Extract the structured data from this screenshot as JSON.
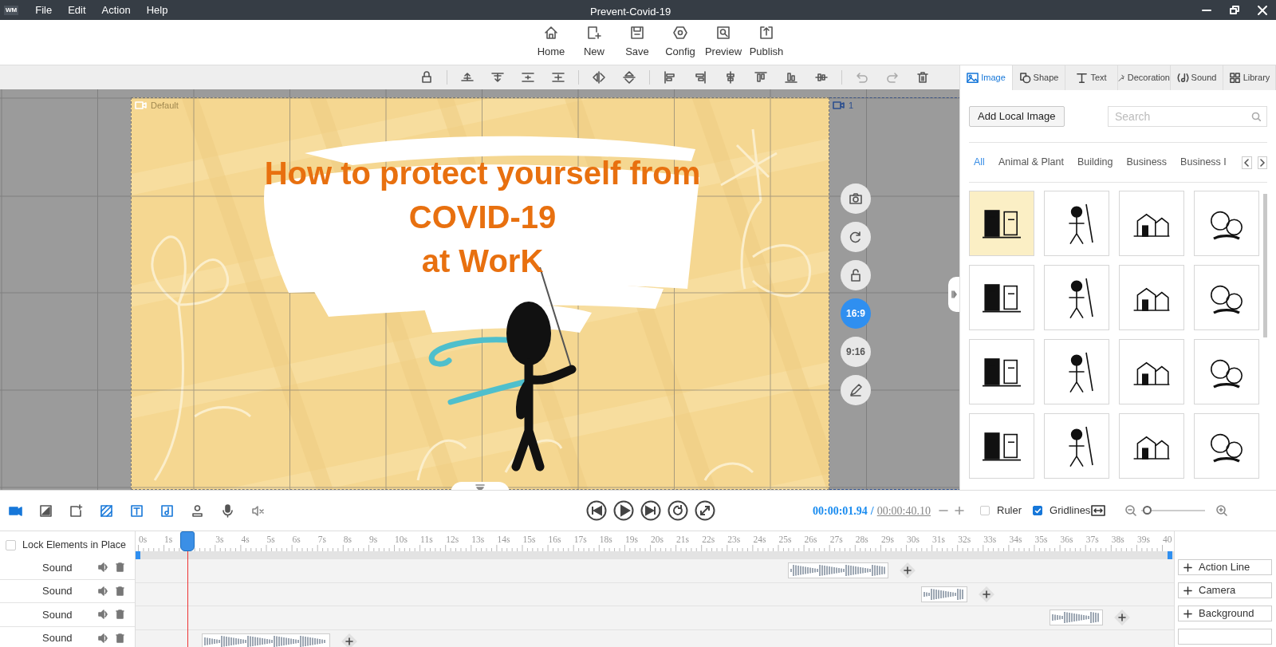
{
  "app_logo": "WM",
  "menu": [
    "File",
    "Edit",
    "Action",
    "Help"
  ],
  "window": {
    "title": "Prevent-Covid-19"
  },
  "ribbon": [
    {
      "label": "Home"
    },
    {
      "label": "New"
    },
    {
      "label": "Save"
    },
    {
      "label": "Config"
    },
    {
      "label": "Preview"
    },
    {
      "label": "Publish"
    }
  ],
  "slide": {
    "camera_label": "Default",
    "title_lines": [
      "How to protect yourself from",
      "COVID-19",
      "at WorK"
    ]
  },
  "next_scene": {
    "label": "1"
  },
  "aspect_ratios": [
    {
      "label": "16:9",
      "selected": true
    },
    {
      "label": "9:16",
      "selected": false
    }
  ],
  "panel": {
    "tabs": [
      {
        "label": "Image",
        "selected": true
      },
      {
        "label": "Shape",
        "selected": false
      },
      {
        "label": "Text",
        "selected": false
      },
      {
        "label": "Decoration",
        "selected": false
      },
      {
        "label": "Sound",
        "selected": false
      },
      {
        "label": "Library",
        "selected": false
      }
    ],
    "add_button": "Add Local Image",
    "search": {
      "placeholder": "Search"
    },
    "categories": [
      {
        "label": "All",
        "selected": true
      },
      {
        "label": "Animal & Plant",
        "selected": false
      },
      {
        "label": "Building",
        "selected": false
      },
      {
        "label": "Business",
        "selected": false
      },
      {
        "label": "Business I",
        "selected": false
      }
    ],
    "thumbnails": [
      {
        "selected": true
      },
      {
        "selected": false
      },
      {
        "selected": false
      },
      {
        "selected": false
      },
      {
        "selected": false
      },
      {
        "selected": false
      },
      {
        "selected": false
      },
      {
        "selected": false
      },
      {
        "selected": false
      },
      {
        "selected": false
      },
      {
        "selected": false
      },
      {
        "selected": false
      },
      {
        "selected": false
      },
      {
        "selected": false
      },
      {
        "selected": false
      },
      {
        "selected": false
      }
    ]
  },
  "player": {
    "current_time": "00:00:01.94",
    "separator": "/",
    "total_time": "00:00:40.10",
    "ruler": {
      "label": "Ruler",
      "checked": false
    },
    "gridlines": {
      "label": "Gridlines",
      "checked": true
    },
    "zoom": {
      "level": 0.02
    }
  },
  "timeline": {
    "lock": {
      "label": "Lock Elements in Place",
      "checked": false
    },
    "ticks": [
      "0s",
      "1s",
      "3s",
      "4s",
      "5s",
      "6s",
      "7s",
      "8s",
      "9s",
      "10s",
      "11s",
      "12s",
      "13s",
      "14s",
      "15s",
      "16s",
      "17s",
      "18s",
      "19s",
      "20s",
      "21s",
      "22s",
      "23s",
      "24s",
      "25s",
      "26s",
      "27s",
      "28s",
      "29s",
      "30s",
      "31s",
      "32s",
      "33s",
      "34s",
      "35s",
      "36s",
      "37s",
      "38s",
      "39s",
      "40"
    ],
    "playhead": {
      "level": 0.0485
    },
    "tracks": [
      {
        "label": "Sound"
      },
      {
        "label": "Sound"
      },
      {
        "label": "Sound"
      },
      {
        "label": "Sound"
      }
    ],
    "add_buttons": [
      "Action Line",
      "Camera",
      "Background"
    ]
  }
}
